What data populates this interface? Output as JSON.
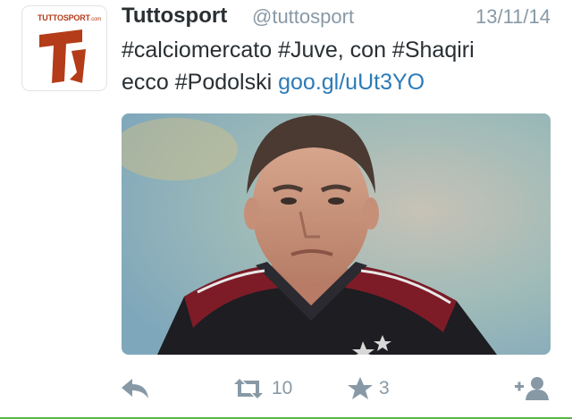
{
  "account": {
    "avatar_brand": "TUTTOSPORT",
    "avatar_brand_suffix": ".com",
    "name": "Tuttosport",
    "handle": "@tuttosport",
    "date": "13/11/14"
  },
  "tweet": {
    "line1": "#calciomercato #Juve, con #Shaqiri",
    "line2_text": "ecco #Podolski ",
    "line2_link": "goo.gl/uUt3YO"
  },
  "actions": {
    "retweet_count": "10",
    "favorite_count": "3"
  },
  "colors": {
    "accent_link": "#2b7bb9",
    "muted": "#8899a6",
    "brand_red": "#b43c18"
  }
}
